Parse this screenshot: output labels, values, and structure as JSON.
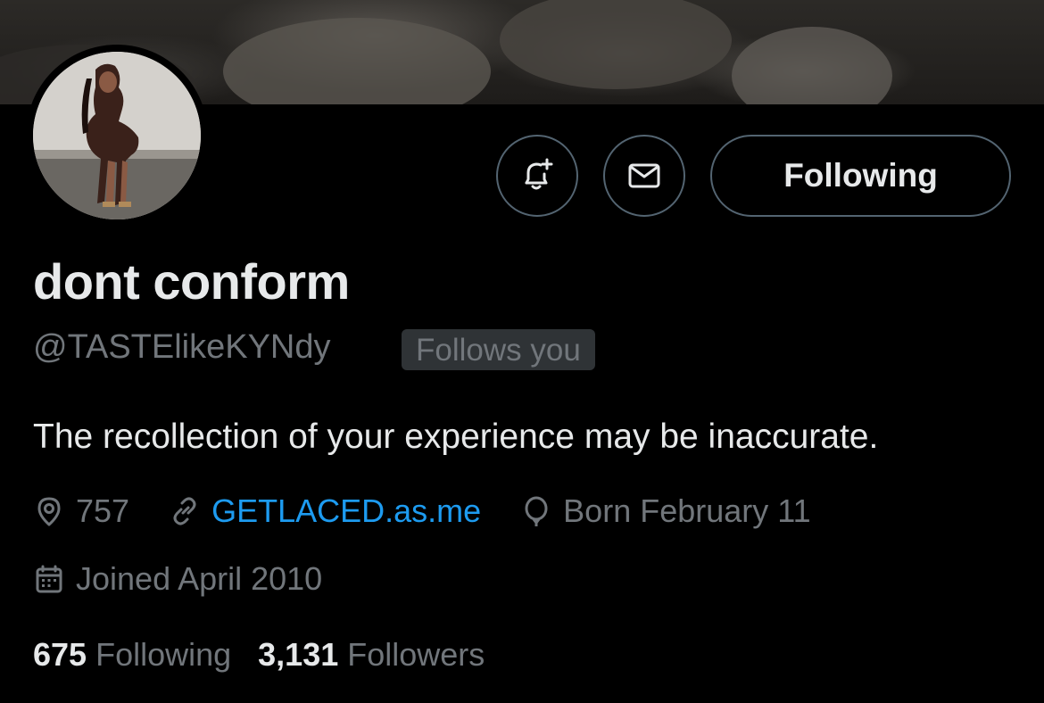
{
  "profile": {
    "display_name": "dont conform",
    "handle": "@TASTElikeKYNdy",
    "follows_you_badge": "Follows you",
    "bio": "The recollection of your experience may be inaccurate.",
    "location": "757",
    "website": "GETLACED.as.me",
    "birthday": "Born February 11",
    "joined": "Joined April 2010"
  },
  "actions": {
    "notify_icon": "bell-plus-icon",
    "message_icon": "mail-icon",
    "following_label": "Following"
  },
  "stats": {
    "following_count": "675",
    "following_label": "Following",
    "followers_count": "3,131",
    "followers_label": "Followers"
  },
  "colors": {
    "background": "#000000",
    "text_primary": "#e7e9ea",
    "text_secondary": "#71767b",
    "link": "#1d9bf0",
    "border": "#536471",
    "badge_bg": "#2f3336"
  }
}
